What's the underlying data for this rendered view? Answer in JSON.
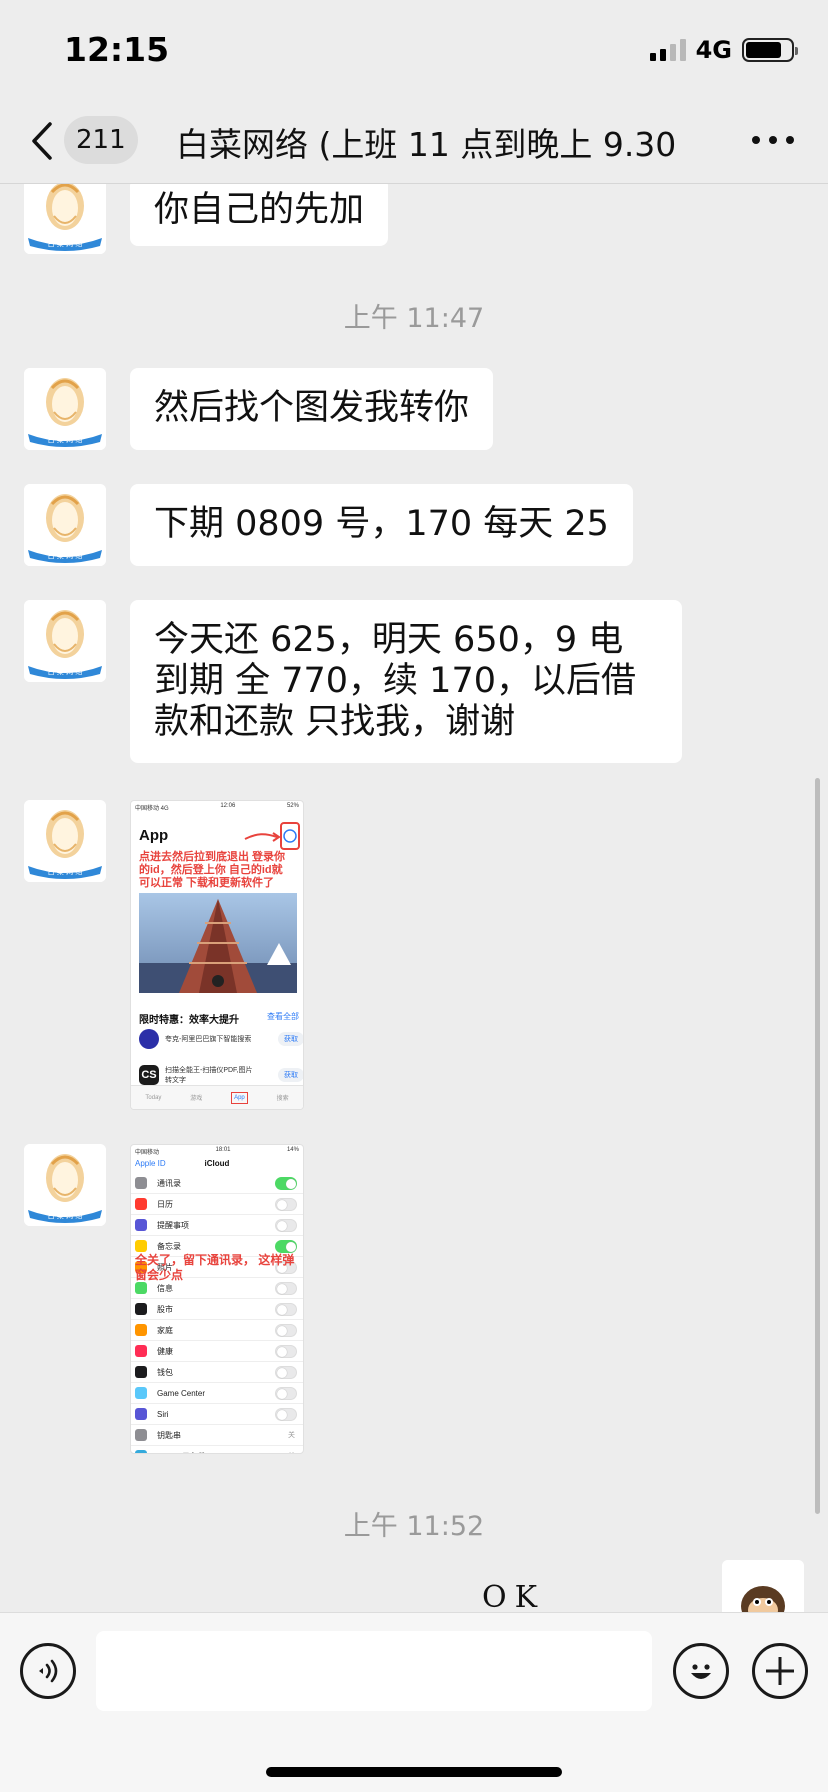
{
  "status_bar": {
    "time": "12:15",
    "network": "4G",
    "battery_percent": 80
  },
  "nav": {
    "unread_count": "211",
    "title": "白菜网络 (上班 11 点到晚上 9.30"
  },
  "contact_avatar_text": "白 菜 网 络",
  "messages": [
    {
      "type": "text",
      "text": "你自己的先加"
    },
    {
      "type": "time",
      "text": "上午 11:47"
    },
    {
      "type": "text",
      "text": "然后找个图发我转你"
    },
    {
      "type": "text",
      "text": "下期 0809 号，170 每天 25"
    },
    {
      "type": "text",
      "text": "今天还 625，明天 650，9 电到期 全 770，续 170，以后借款和还款 只找我，谢谢"
    },
    {
      "type": "image",
      "kind": "appstore"
    },
    {
      "type": "image",
      "kind": "icloud"
    },
    {
      "type": "time",
      "text": "上午 11:52"
    },
    {
      "type": "text_out",
      "text": "OK"
    }
  ],
  "thumb_appstore": {
    "status_left": "中国移动 4G",
    "status_time": "12:06",
    "status_right": "52%",
    "title": "App",
    "annotation": "点进去然后拉到底退出 登录你的id，然后登上你 自己的id就可以正常 下载和更新软件了",
    "section": "限时特惠：效率大提升",
    "see_all": "查看全部",
    "apps": [
      {
        "name": "夸克-阿里巴巴旗下智能搜索",
        "get": "获取",
        "icon_color": "#2b2fa8"
      },
      {
        "name": "扫描全能王-扫描仪PDF,图片转文字",
        "get": "获取",
        "icon_color": "#1b1b1b"
      }
    ],
    "tabs": [
      "Today",
      "游戏",
      "App",
      "搜索"
    ]
  },
  "thumb_icloud": {
    "status_left": "中国移动",
    "status_time": "18:01",
    "status_right": "14%",
    "back": "Apple ID",
    "title": "iCloud",
    "annotation": "全关了，留下通讯录， 这样弹窗会少点",
    "rows": [
      {
        "label": "通讯录",
        "on": true,
        "color": "#8e8e93"
      },
      {
        "label": "日历",
        "on": false,
        "color": "#ff3b30"
      },
      {
        "label": "提醒事项",
        "on": false,
        "color": "#5856d6"
      },
      {
        "label": "备忘录",
        "on": true,
        "color": "#ffcc00"
      },
      {
        "label": "照片",
        "on": false,
        "color": "#ff9500"
      },
      {
        "label": "信息",
        "on": false,
        "color": "#4cd964"
      },
      {
        "label": "股市",
        "on": false,
        "color": "#1c1c1e"
      },
      {
        "label": "家庭",
        "on": false,
        "color": "#ff9500"
      },
      {
        "label": "健康",
        "on": false,
        "color": "#ff2d55"
      },
      {
        "label": "钱包",
        "on": false,
        "color": "#1c1c1e"
      },
      {
        "label": "Game Center",
        "on": false,
        "color": "#5ac8fa"
      },
      {
        "label": "Siri",
        "on": false,
        "color": "#5856d6"
      },
      {
        "label": "钥匙串",
        "value": "关",
        "color": "#8e8e93"
      },
      {
        "label": "iCloud 云备份",
        "value": "关",
        "color": "#34aadc"
      }
    ]
  },
  "input": {
    "placeholder": ""
  },
  "icons": [
    "back-icon",
    "more-icon",
    "voice-icon",
    "emoji-icon",
    "plus-icon"
  ]
}
